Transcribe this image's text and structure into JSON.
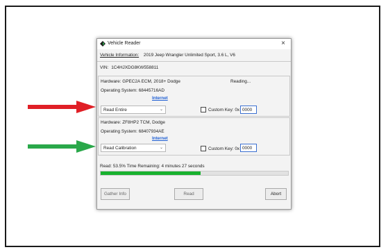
{
  "window": {
    "title": "Vehicle Reader",
    "close_glyph": "×"
  },
  "vehicle": {
    "info_label": "Vehicle Information:",
    "info_value": "2019 Jeep Wrangler Unlimited Sport, 3.6 L, V6",
    "vin_label": "VIN:",
    "vin_value": "1C4HJXDG8KW558811"
  },
  "modules": [
    {
      "hardware": "Hardware: GPEC2A ECM, 2018+ Dodge",
      "os": "Operating System: 68445716AD",
      "link": "Internet",
      "status": "Reading...",
      "mode": "Read Entire",
      "custom_key_label": "Custom Key: 0x",
      "custom_key_value": "0000"
    },
    {
      "hardware": "Hardware: ZF8HP2 TCM, Dodge",
      "os": "Operating System: 68407934AE",
      "link": "Internet",
      "status": "",
      "mode": "Read Calibration",
      "custom_key_label": "Custom Key: 0x",
      "custom_key_value": "0000"
    }
  ],
  "progress": {
    "text": "Read: 53.5% Time Remaining: 4 minutes 27 seconds",
    "percent": 53.5
  },
  "buttons": {
    "gather": "Gather Info",
    "read": "Read",
    "abort": "Abort"
  },
  "colors": {
    "arrow_red": "#e01f26",
    "arrow_green": "#2aa84a",
    "progress_fill": "#18b12e",
    "link": "#1f5fd4"
  },
  "icons": {
    "app": "diamond-app-icon",
    "close": "close-icon",
    "dropdown": "chevron-down-icon"
  }
}
